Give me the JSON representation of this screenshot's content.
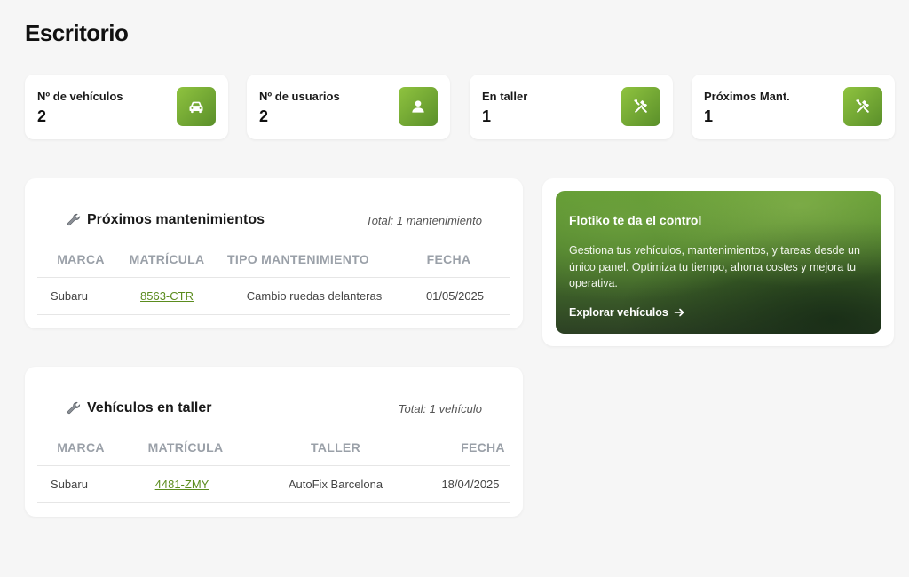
{
  "page": {
    "title": "Escritorio"
  },
  "stats": [
    {
      "label": "Nº de vehículos",
      "value": "2",
      "icon": "car-icon"
    },
    {
      "label": "Nº de usuarios",
      "value": "2",
      "icon": "user-icon"
    },
    {
      "label": "En taller",
      "value": "1",
      "icon": "tools-icon"
    },
    {
      "label": "Próximos Mant.",
      "value": "1",
      "icon": "tools-icon"
    }
  ],
  "maintenance": {
    "title": "Próximos mantenimientos",
    "total": "Total: 1 mantenimiento",
    "columns": [
      "MARCA",
      "MATRÍCULA",
      "TIPO MANTENIMIENTO",
      "FECHA"
    ],
    "rows": [
      {
        "brand": "Subaru",
        "plate": "8563-CTR",
        "type": "Cambio ruedas delanteras",
        "date": "01/05/2025"
      }
    ]
  },
  "workshop": {
    "title": "Vehículos en taller",
    "total": "Total: 1 vehículo",
    "columns": [
      "MARCA",
      "MATRÍCULA",
      "TALLER",
      "FECHA"
    ],
    "rows": [
      {
        "brand": "Subaru",
        "plate": "4481-ZMY",
        "workshop": "AutoFix Barcelona",
        "date": "18/04/2025"
      }
    ]
  },
  "promo": {
    "title": "Flotiko te da el control",
    "text": "Gestiona tus vehículos, mantenimientos, y tareas desde un único panel. Optimiza tu tiempo, ahorra costes y mejora tu operativa.",
    "link": "Explorar vehículos"
  },
  "colors": {
    "accent": "#6fa52b",
    "link": "#5b8c1e",
    "background": "#f6f6f6"
  }
}
